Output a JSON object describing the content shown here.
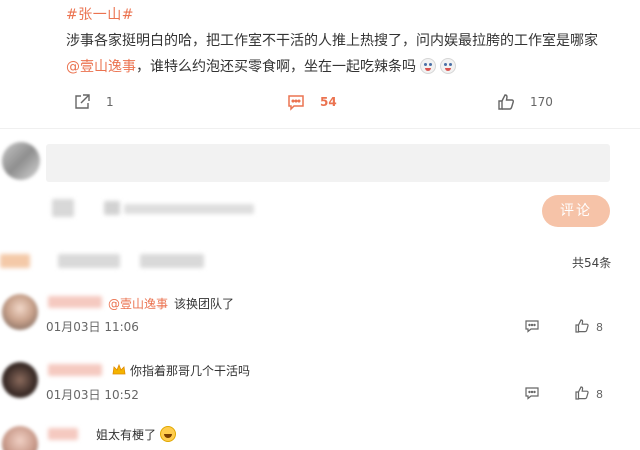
{
  "post": {
    "hashtag": "#张一山#",
    "line1": "涉事各家挺明白的哈，把工作室不干活的人推上热搜了，问内娱最拉胯的工作室是哪家",
    "mention": "@壹山逸事",
    "line2_rest": "，谁特么约泡还买零食啊，坐在一起吃辣条吗",
    "share_count": "1",
    "comment_count": "54",
    "like_count": "170"
  },
  "composer": {
    "submit_label": "评论"
  },
  "comments_header": {
    "total_label": "共54条"
  },
  "comments": [
    {
      "mention": "@壹山逸事",
      "text": "该换团队了",
      "time": "01月03日 11:06",
      "likes": "8"
    },
    {
      "text": "你指着那哥几个干活吗",
      "time": "01月03日 10:52",
      "likes": "8"
    },
    {
      "text": "姐太有梗了"
    }
  ],
  "colors": {
    "accent": "#eb7350",
    "submit_bg": "#f6c3a8",
    "input_bg": "#f2f2f2"
  },
  "icons": {
    "share": "share-icon",
    "comment": "comment-icon",
    "like": "thumbs-up-icon",
    "reply": "reply-icon",
    "crown": "crown-icon",
    "emoji": "emoji-icon"
  }
}
